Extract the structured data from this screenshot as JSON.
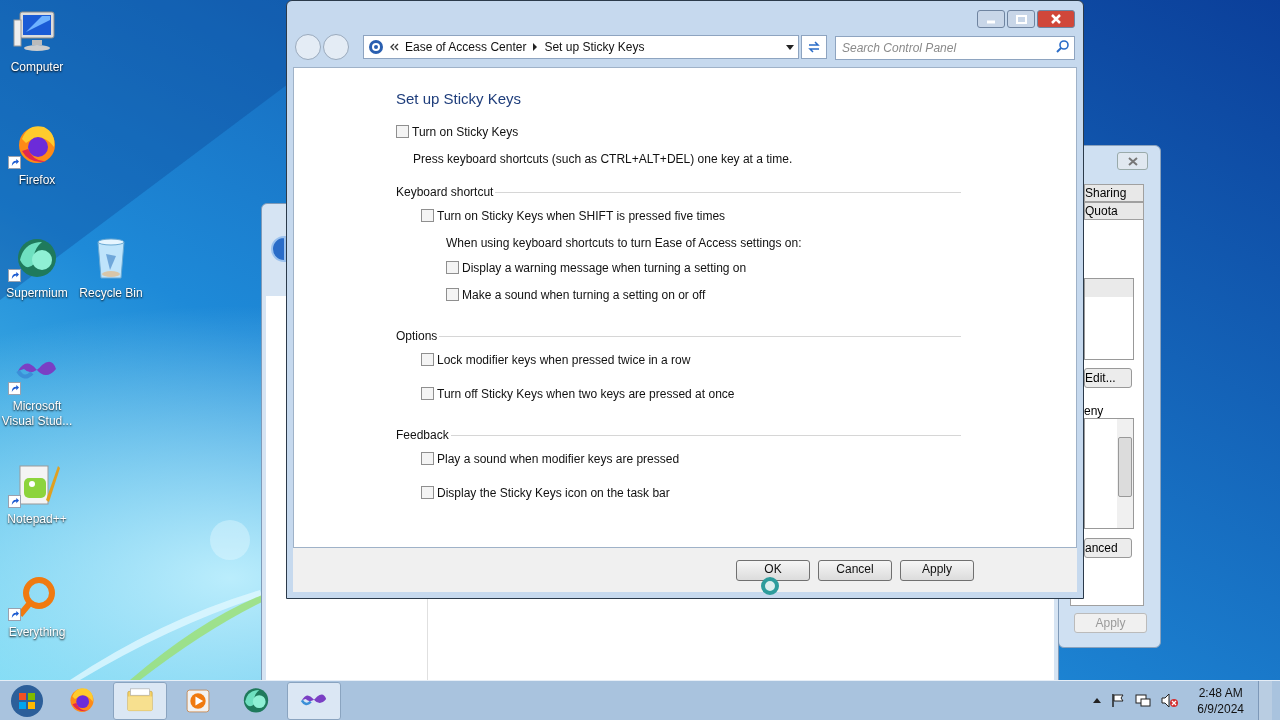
{
  "desktop_icons": [
    {
      "label": "Computer",
      "kind": "computer",
      "shortcut": false
    },
    {
      "label": "Firefox",
      "kind": "firefox",
      "shortcut": true
    },
    {
      "label": "Supermium",
      "kind": "supermium",
      "shortcut": true
    },
    {
      "label": "Recycle Bin",
      "kind": "recycle",
      "shortcut": false
    },
    {
      "label": "Microsoft Visual Stud...",
      "kind": "vs",
      "shortcut": true
    },
    {
      "label": "Notepad++",
      "kind": "notepad",
      "shortcut": true
    },
    {
      "label": "Everything",
      "kind": "everything",
      "shortcut": true
    }
  ],
  "properties_window": {
    "tabs": [
      {
        "label": "Sharing"
      },
      {
        "label": "Quota"
      }
    ],
    "edit_button": "Edit...",
    "deny_label": "eny",
    "advanced_button": "anced",
    "apply_button": {
      "label": "Apply",
      "disabled": true
    }
  },
  "window": {
    "breadcrumb": [
      "Ease of Access Center",
      "Set up Sticky Keys"
    ],
    "search": {
      "placeholder": "Search Control Panel"
    },
    "heading": "Set up Sticky Keys",
    "main_option": {
      "label": "Turn on Sticky Keys",
      "checked": false
    },
    "main_description": "Press keyboard shortcuts (such as CTRL+ALT+DEL) one key at a time.",
    "sections": [
      {
        "title": "Keyboard shortcut",
        "items": [
          {
            "kind": "checkbox",
            "label": "Turn on Sticky Keys when SHIFT is pressed five times",
            "checked": false
          },
          {
            "kind": "note",
            "label": "When using keyboard shortcuts to turn Ease of Access settings on:",
            "children": [
              {
                "kind": "checkbox",
                "label": "Display a warning message when turning a setting on",
                "checked": false
              },
              {
                "kind": "checkbox",
                "label": "Make a sound when turning a setting on or off",
                "checked": false
              }
            ]
          }
        ]
      },
      {
        "title": "Options",
        "items": [
          {
            "kind": "checkbox",
            "label": "Lock modifier keys when pressed twice in a row",
            "checked": false
          },
          {
            "kind": "checkbox",
            "label": "Turn off Sticky Keys when two keys are pressed at once",
            "checked": false
          }
        ]
      },
      {
        "title": "Feedback",
        "items": [
          {
            "kind": "checkbox",
            "label": "Play a sound when modifier keys are pressed",
            "checked": false
          },
          {
            "kind": "checkbox",
            "label": "Display the Sticky Keys icon on the task bar",
            "checked": false
          }
        ]
      }
    ],
    "buttons": [
      "OK",
      "Cancel",
      "Apply"
    ]
  },
  "taskbar": {
    "items": [
      {
        "kind": "firefox",
        "selected": false
      },
      {
        "kind": "explorer",
        "selected": true
      },
      {
        "kind": "media",
        "selected": false
      },
      {
        "kind": "supermium",
        "selected": false
      },
      {
        "kind": "vs",
        "selected": true
      }
    ],
    "time": "2:48 AM",
    "date": "6/9/2024"
  }
}
